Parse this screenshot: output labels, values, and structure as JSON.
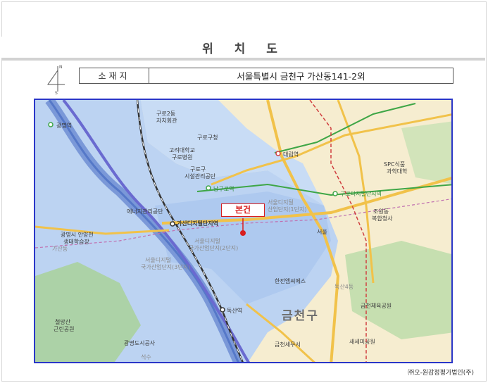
{
  "header": {
    "title": "위 치 도"
  },
  "compass": {
    "north": "N",
    "south": "S"
  },
  "address": {
    "label": "소재지",
    "value": "서울특별시 금천구 가산동141-2외"
  },
  "map": {
    "subject_label": "본건",
    "labels": {
      "guro2": "구로2동",
      "guro2_office": "자치회관",
      "gwangmyeong_station": "광명역",
      "guro_office": "구로구청",
      "korea_univ": "고려대학교",
      "guro_hospital": "구로병원",
      "facilities": "구로구",
      "facilities2": "시설관리공단",
      "daerim": "대림역",
      "namguro": "남구로역",
      "spc": "SPC식품",
      "spc2": "과학대학",
      "guro_digital": "구로디지털단지역",
      "energy": "에너지관리공단",
      "gasan_digital": "가산디지털단지역",
      "digital1": "서울디지털",
      "digital1b": "산업단지(1단지)",
      "jorwon": "조원동",
      "jorwon2": "복합청사",
      "gwangmyeong_yeok": "광명시 안양천",
      "gwangmyeong_yeok2": "생태학습장",
      "seoul_gate": "서울",
      "digital2": "서울디지털",
      "digital2b": "국가산업단지(2단지)",
      "digital3": "서울디지털",
      "digital3b": "국가산업단지(3단지)",
      "hanjeon": "한전엠씨에스",
      "geumcheon_stadium": "금천체육공원",
      "doksan_station": "독산역",
      "geumcheon_gu": "금천구",
      "cheolsan": "철망산",
      "geunrin": "근린공원",
      "gwangmyeong_corp": "광명도시공사",
      "geumcheon_office": "금천세무서",
      "saesemi": "새세미공원",
      "gasan": "가산동",
      "doksan4": "독산4동",
      "seoksu": "석수"
    }
  },
  "footer": {
    "text": "㈜오-원감정평가법인(주)"
  }
}
